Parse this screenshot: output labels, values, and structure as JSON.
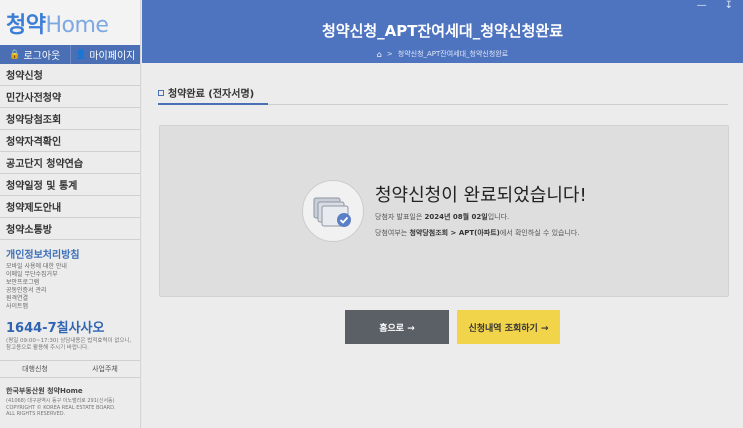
{
  "sidebar": {
    "logo_main": "청약",
    "logo_sub": "Home",
    "logout_label": "로그아웃",
    "mypage_label": "마이페이지",
    "menu": [
      "청약신청",
      "민간사전청약",
      "청약당첨조회",
      "청약자격확인",
      "공고단지 청약연습",
      "청약일정 및 통계",
      "청약제도안내",
      "청약소통방"
    ],
    "privacy_title": "개인정보처리방침",
    "sub_links": [
      "모바일 사용에 대한 안내",
      "이메일 무단수집거부",
      "보안프로그램",
      "공동인증서 관리",
      "원격연결",
      "사이트맵"
    ],
    "phone": "1644-7",
    "phone_word": "칠사사오",
    "phone_note": "(평일 09:00~17:30) 상담내용은 법적효력이 없으니, 참고용으로 활용해 주시기 바랍니다.",
    "foot_links": [
      "대행신청",
      "사업주체"
    ],
    "org_name": "한국부동산원 청약Home",
    "org_addr": "(41068) 대구광역시 동구 이노밸리로 291(신서동)\nCOPYRIGHT © KOREA REAL ESTATE BOARD.\nALL RIGHTS RESERVED."
  },
  "header": {
    "title": "청약신청_APT잔여세대_청약신청완료",
    "breadcrumb": "청약신청_APT잔여세대_청약신청완료"
  },
  "content": {
    "section_tab": "청약완료 (전자서명)",
    "done_title": "청약신청이 완료되었습니다!",
    "announce_prefix": "당첨자 발표일은 ",
    "announce_date": "2024년 08월 02일",
    "announce_suffix": "입니다.",
    "check_prefix": "당첨여부는 ",
    "check_path": "청약당첨조회 > APT(아파트)",
    "check_suffix": "에서 확인하실 수 있습니다.",
    "home_button": "홈으로 →",
    "history_button": "신청내역 조회하기 →"
  },
  "colors": {
    "header_blue": "#4f74bf",
    "home_button": "#5b5f66",
    "history_button": "#f2d44a"
  },
  "icons": {
    "home": "home-icon",
    "check": "check-badge-icon"
  }
}
